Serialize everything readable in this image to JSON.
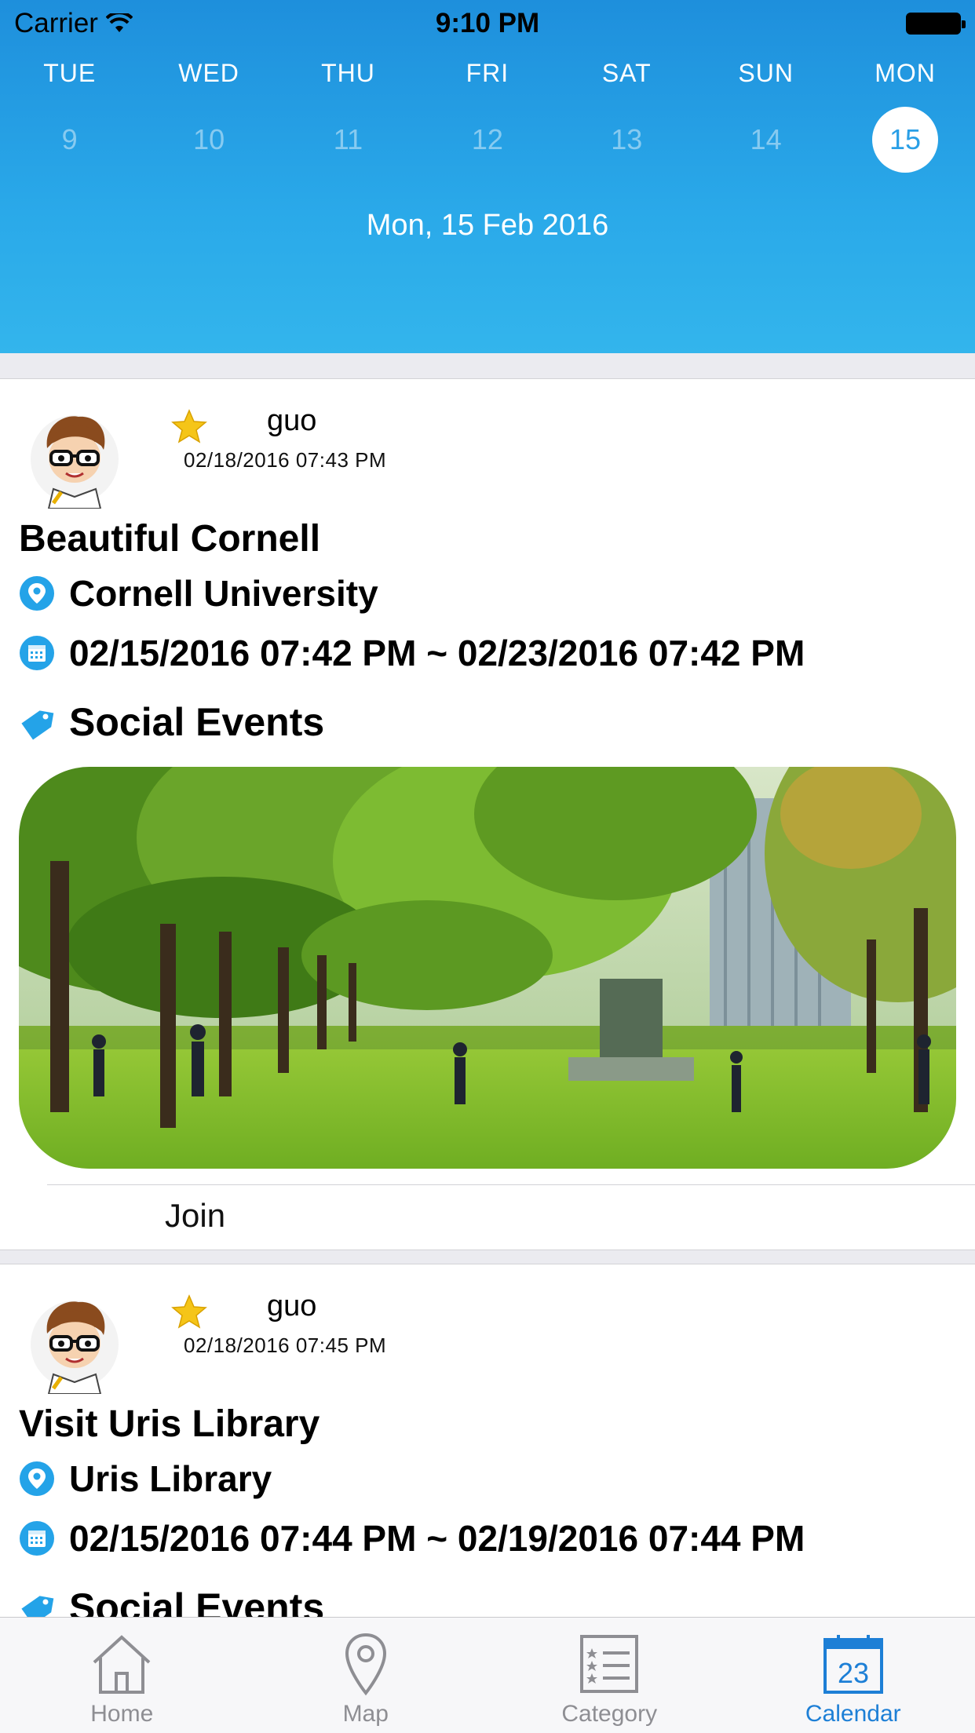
{
  "status": {
    "carrier": "Carrier",
    "time": "9:10 PM"
  },
  "calendar": {
    "weekdays": [
      "TUE",
      "WED",
      "THU",
      "FRI",
      "SAT",
      "SUN",
      "MON"
    ],
    "dates": [
      "9",
      "10",
      "11",
      "12",
      "13",
      "14",
      "15"
    ],
    "selected_index": 6,
    "selected_label": "Mon, 15 Feb 2016"
  },
  "events": [
    {
      "user": "guo",
      "posted": "02/18/2016 07:43 PM",
      "title": "Beautiful Cornell",
      "location": "Cornell University",
      "time_range": "02/15/2016 07:42 PM ~ 02/23/2016 07:42 PM",
      "category": "Social Events",
      "join_label": "Join"
    },
    {
      "user": "guo",
      "posted": "02/18/2016 07:45 PM",
      "title": "Visit Uris Library",
      "location": "Uris Library",
      "time_range": "02/15/2016 07:44 PM ~ 02/19/2016 07:44 PM",
      "category": "Social Events"
    }
  ],
  "tabbar": {
    "items": [
      {
        "label": "Home",
        "icon": "home-icon"
      },
      {
        "label": "Map",
        "icon": "map-pin-icon"
      },
      {
        "label": "Category",
        "icon": "list-icon"
      },
      {
        "label": "Calendar",
        "icon": "calendar-icon",
        "badge": "23"
      }
    ],
    "active_index": 3
  },
  "colors": {
    "header_blue": "#2aa9e6",
    "accent": "#1d7fd6",
    "icon_blue": "#24a3e8",
    "star": "#f5c518"
  }
}
